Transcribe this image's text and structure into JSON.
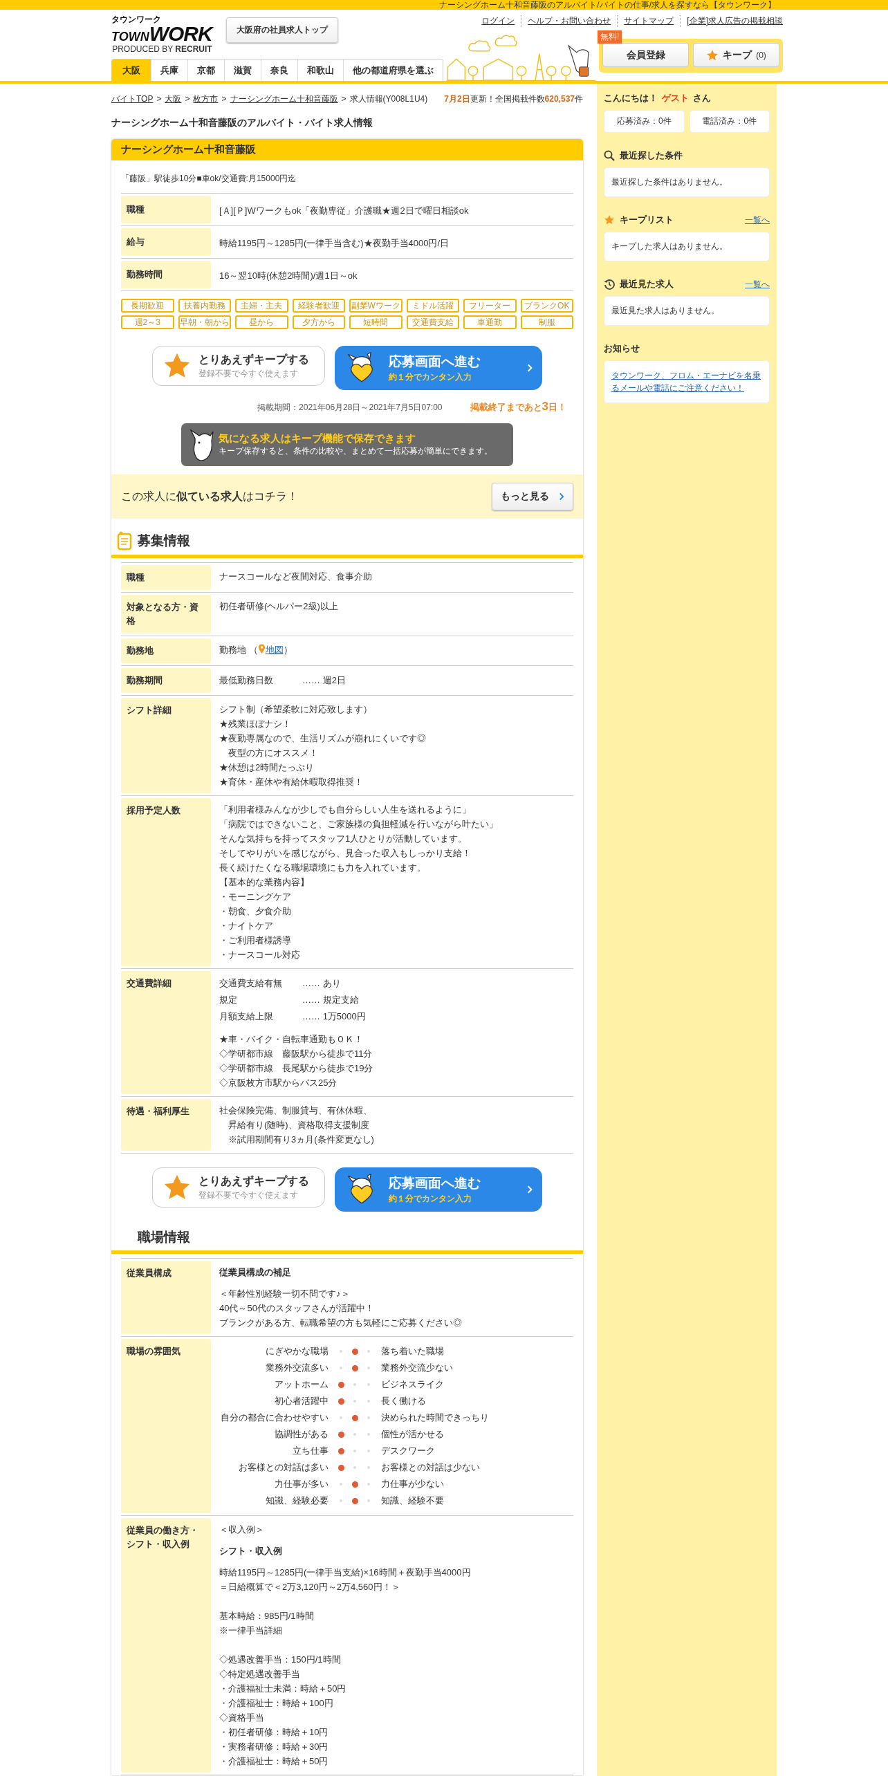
{
  "top_bar": {
    "text": "ナーシングホーム十和音藤阪のアルバイト/バイトの仕事/求人を探すなら【タウンワーク】"
  },
  "header": {
    "logo": {
      "kana": "タウンワーク",
      "town": "TOWN",
      "work": "WORK",
      "produced": "PRODUCED BY",
      "brand": "RECRUIT"
    },
    "top_button": "大阪府の社員求人トップ",
    "links": [
      "ログイン",
      "ヘルプ・お問い合わせ",
      "サイトマップ",
      "[企業]求人広告の掲載相談"
    ],
    "tabs": [
      {
        "label": "大阪",
        "selected": true
      },
      {
        "label": "兵庫",
        "selected": false
      },
      {
        "label": "京都",
        "selected": false
      },
      {
        "label": "滋賀",
        "selected": false
      },
      {
        "label": "奈良",
        "selected": false
      },
      {
        "label": "和歌山",
        "selected": false
      },
      {
        "label": "他の都道府県を選ぶ",
        "selected": false
      }
    ],
    "register": {
      "label": "会員登録",
      "badge": "無料!"
    },
    "keep": {
      "label": "キープ",
      "count": "(0)"
    }
  },
  "breadcrumb": {
    "items": [
      "バイトTOP",
      "大阪",
      "枚方市",
      "ナーシングホーム十和音藤阪"
    ],
    "separator": ">",
    "current": "求人情報(Y008L1U4)"
  },
  "update": {
    "date": "7月2日",
    "text": "更新！全国掲載件数",
    "count": "620,537",
    "unit": "件"
  },
  "page_title": "ナーシングホーム十和音藤阪のアルバイト・バイト求人情報",
  "job": {
    "name": "ナーシングホーム十和音藤阪",
    "access": "「藤阪」駅徒歩10分■車ok/交通費:月15000円迄",
    "summary": [
      {
        "label": "職種",
        "value": "[Ａ][Ｐ]Wワークもok「夜勤専従」介護職★週2日で曜日相談ok"
      },
      {
        "label": "給与",
        "value": "時給1195円～1285円(一律手当含む)★夜勤手当4000円/日"
      },
      {
        "label": "勤務時間",
        "value": "16～翌10時(休憩2時間)/週1日～ok"
      }
    ],
    "tags": [
      "長期歓迎",
      "扶養内勤務",
      "主婦・主夫",
      "経験者歓迎",
      "副業Wワーク",
      "ミドル活躍",
      "フリーター",
      "ブランクOK",
      "週2～3",
      "早朝・朝から",
      "昼から",
      "夕方から",
      "短時間",
      "交通費支給",
      "車通勤",
      "制服"
    ],
    "keep_button": {
      "title": "とりあえずキープする",
      "sub": "登録不要で今すぐ使えます"
    },
    "apply_button": {
      "title": "応募画面へ進む",
      "sub": "約１分でカンタン入力"
    },
    "period": "掲載期間：2021年06月28日～2021年7月5日07:00",
    "remaining": {
      "before": "掲載終了まであと",
      "days": "3",
      "after": "日！"
    },
    "keep_banner": {
      "title": "気になる求人はキープ機能で保存できます",
      "sub": "キープ保存すると、条件の比較や、まとめて一括応募が簡単にできます。"
    },
    "similar": {
      "text": "この求人に**似ている求人**はコチラ！",
      "button": "もっと見る"
    }
  },
  "sections": [
    {
      "title": "募集情報",
      "icon": true,
      "rows": [
        {
          "label": "職種",
          "blocks": [
            {
              "kind": "text",
              "lines": [
                "ナースコールなど夜間対応、食事介助"
              ]
            }
          ]
        },
        {
          "label": "対象となる方・資格",
          "blocks": [
            {
              "kind": "text",
              "lines": [
                "初任者研修(ヘルパー2級)以上"
              ]
            }
          ]
        },
        {
          "label": "勤務地",
          "blocks": [
            {
              "kind": "location",
              "text": "勤務地",
              "open": "（",
              "link": "地図",
              "close": "）"
            }
          ]
        },
        {
          "label": "勤務期間",
          "blocks": [
            {
              "kind": "pairs",
              "items": [
                {
                  "key": "最低勤務日数",
                  "leader": "……",
                  "value": "週2日"
                }
              ]
            }
          ]
        },
        {
          "label": "シフト詳細",
          "blocks": [
            {
              "kind": "text",
              "lines": [
                "シフト制（希望柔軟に対応致します）",
                "★残業ほぼナシ！",
                "★夜勤専属なので、生活リズムが崩れにくいです◎",
                "　夜型の方にオススメ！",
                "★休憩は2時間たっぷり",
                "★育休・産休や有給休暇取得推奨！"
              ]
            }
          ]
        },
        {
          "label": "採用予定人数",
          "blocks": [
            {
              "kind": "text",
              "lines": [
                "「利用者様みんなが少しでも自分らしい人生を送れるように」",
                "「病院ではできないこと、ご家族様の負担軽減を行いながら叶たい」",
                "そんな気持ちを持ってスタッフ1人ひとりが活動しています。",
                "そしてやりがいを感じながら、見合った収入もしっかり支給！",
                "長く続けたくなる職場環境にも力を入れています。",
                "【基本的な業務内容】",
                "・モーニングケア",
                "・朝食、夕食介助",
                "・ナイトケア",
                "・ご利用者様誘導",
                "・ナースコール対応"
              ]
            }
          ]
        },
        {
          "label": "交通費詳細",
          "blocks": [
            {
              "kind": "pairs",
              "items": [
                {
                  "key": "交通費支給有無",
                  "leader": "……",
                  "value": "あり"
                },
                {
                  "key": "規定",
                  "leader": "……",
                  "value": "規定支給"
                },
                {
                  "key": "月額支給上限",
                  "leader": "……",
                  "value": "1万5000円"
                }
              ]
            },
            {
              "kind": "text",
              "lines": [
                "★車・バイク・自転車通勤もＯＫ！",
                "◇学研都市線　藤阪駅から徒歩で11分",
                "◇学研都市線　長尾駅から徒歩で19分",
                "◇京阪枚方市駅からバス25分"
              ]
            }
          ]
        },
        {
          "label": "待遇・福利厚生",
          "blocks": [
            {
              "kind": "text",
              "lines": [
                "社会保険完備、制服貸与、有休休暇、",
                "　昇給有り(随時)、資格取得支援制度",
                "　※試用期間有り3ヵ月(条件変更なし)"
              ]
            }
          ]
        }
      ],
      "buttons": {
        "keep_button": {
          "title": "とりあえずキープする",
          "sub": "登録不要で今すぐ使えます"
        },
        "apply_button": {
          "title": "応募画面へ進む",
          "sub": "約１分でカンタン入力"
        }
      }
    },
    {
      "title": "職場情報",
      "icon": false,
      "rows": [
        {
          "label": "従業員構成",
          "blocks": [
            {
              "kind": "heading",
              "text": "従業員構成の補足"
            },
            {
              "kind": "text",
              "lines": [
                "＜年齢性別経験一切不問です♪＞",
                "40代～50代のスタッフさんが活躍中！",
                "ブランクがある方、転職希望の方も気軽にご応募ください◎"
              ]
            }
          ]
        },
        {
          "label": "職場の雰囲気",
          "blocks": [
            {
              "kind": "atmosphere",
              "items": [
                {
                  "left": "にぎやかな職場",
                  "right": "落ち着いた職場",
                  "dots": [
                    {
                      "selected": false
                    },
                    {
                      "selected": true
                    },
                    {
                      "selected": false
                    }
                  ]
                },
                {
                  "left": "業務外交流多い",
                  "right": "業務外交流少ない",
                  "dots": [
                    {
                      "selected": false
                    },
                    {
                      "selected": true
                    },
                    {
                      "selected": false
                    }
                  ]
                },
                {
                  "left": "アットホーム",
                  "right": "ビジネスライク",
                  "dots": [
                    {
                      "selected": true
                    },
                    {
                      "selected": false
                    },
                    {
                      "selected": false
                    }
                  ]
                },
                {
                  "left": "初心者活躍中",
                  "right": "長く働ける",
                  "dots": [
                    {
                      "selected": true
                    },
                    {
                      "selected": false
                    },
                    {
                      "selected": false
                    }
                  ]
                },
                {
                  "left": "自分の都合に合わせやすい",
                  "right": "決められた時間できっちり",
                  "dots": [
                    {
                      "selected": false
                    },
                    {
                      "selected": true
                    },
                    {
                      "selected": false
                    }
                  ]
                },
                {
                  "left": "協調性がある",
                  "right": "個性が活かせる",
                  "dots": [
                    {
                      "selected": true
                    },
                    {
                      "selected": false
                    },
                    {
                      "selected": false
                    }
                  ]
                },
                {
                  "left": "立ち仕事",
                  "right": "デスクワーク",
                  "dots": [
                    {
                      "selected": true
                    },
                    {
                      "selected": false
                    },
                    {
                      "selected": false
                    }
                  ]
                },
                {
                  "left": "お客様との対話は多い",
                  "right": "お客様との対話は少ない",
                  "dots": [
                    {
                      "selected": true
                    },
                    {
                      "selected": false
                    },
                    {
                      "selected": false
                    }
                  ]
                },
                {
                  "left": "力仕事が多い",
                  "right": "力仕事が少ない",
                  "dots": [
                    {
                      "selected": false
                    },
                    {
                      "selected": true
                    },
                    {
                      "selected": false
                    }
                  ]
                },
                {
                  "left": "知識、経験必要",
                  "right": "知識、経験不要",
                  "dots": [
                    {
                      "selected": false
                    },
                    {
                      "selected": true
                    },
                    {
                      "selected": false
                    }
                  ]
                }
              ]
            }
          ]
        },
        {
          "label": "従業員の働き方・シフト・収入例",
          "blocks": [
            {
              "kind": "text",
              "lines": [
                "＜収入例＞"
              ]
            },
            {
              "kind": "heading",
              "text": "シフト・収入例"
            },
            {
              "kind": "text",
              "lines": [
                "時給1195円～1285円(一律手当支給)×16時間＋夜勤手当4000円",
                "＝日給概算で＜2万3,120円～2万4,560円！＞"
              ]
            },
            {
              "kind": "text",
              "lines": [
                "基本時給：985円/1時間",
                "※一律手当詳細"
              ]
            },
            {
              "kind": "text",
              "lines": [
                "◇処遇改善手当：150円/1時間",
                "◇特定処遇改善手当",
                "・介護福祉士未満：時給＋50円",
                "・介護福祉士：時給＋100円",
                "◇資格手当",
                "・初任者研修：時給＋10円",
                "・実務者研修：時給＋30円",
                "・介護福祉士：時給＋50円"
              ]
            }
          ]
        }
      ]
    }
  ],
  "sidebar": {
    "greeting": {
      "hello": "こんにちは！",
      "name": "ゲスト",
      "suffix": "さん"
    },
    "counters": [
      "応募済み：0件",
      "電話済み：0件"
    ],
    "panels": [
      {
        "kind": "search",
        "title": "最近探した条件",
        "text": "最近探した条件はありません。"
      },
      {
        "kind": "star",
        "title": "キープリスト",
        "link": "一覧へ",
        "text": "キープした求人はありません。"
      },
      {
        "kind": "history",
        "title": "最近見た求人",
        "link": "一覧へ",
        "text": "最近見た求人はありません。"
      },
      {
        "kind": "notice",
        "title": "お知らせ",
        "notice_link": "タウンワーク、フロム・エーナビを名乗るメールや電話にご注意ください！"
      }
    ]
  }
}
